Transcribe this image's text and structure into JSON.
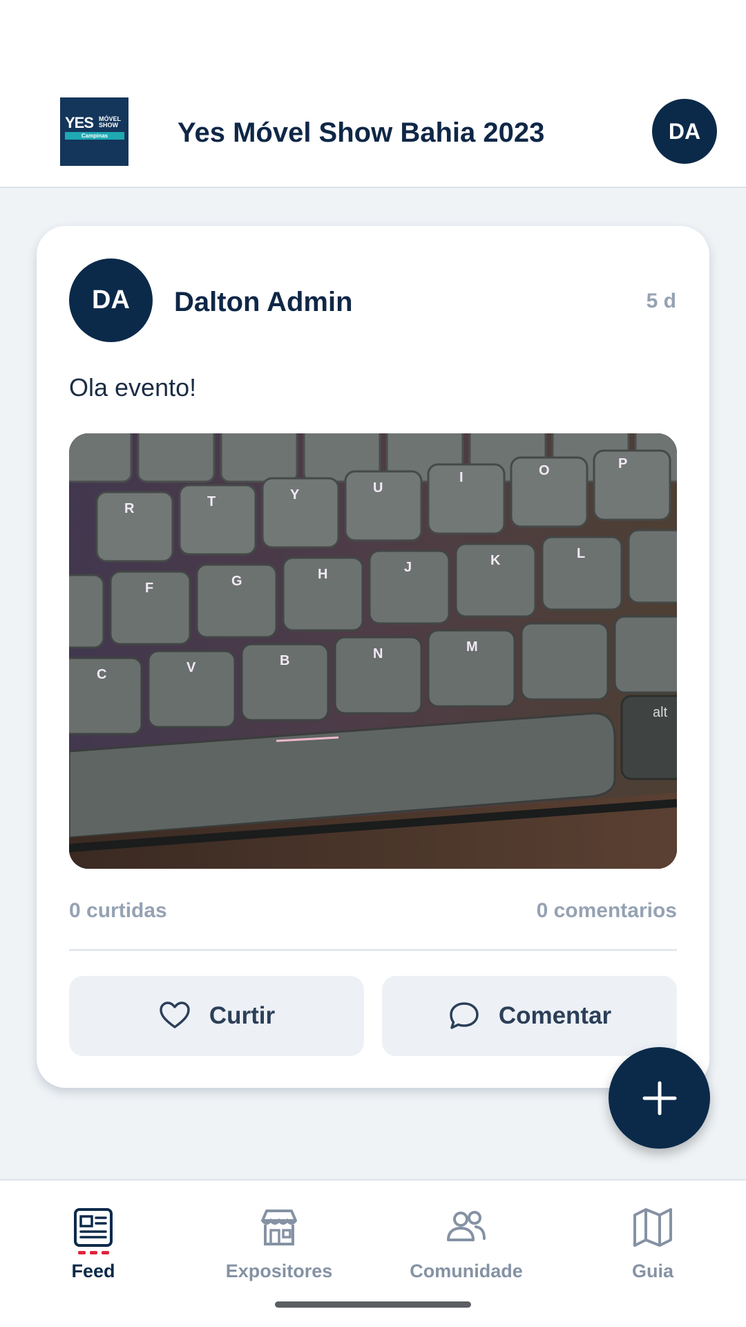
{
  "header": {
    "logo": {
      "line1": "YES",
      "line2": "MÓVEL",
      "line3": "SHOW",
      "city": "Campinas"
    },
    "title": "Yes Móvel Show Bahia 2023",
    "avatar_initials": "DA"
  },
  "post": {
    "avatar_initials": "DA",
    "author": "Dalton Admin",
    "time": "5 d",
    "text": "Ola evento!",
    "image": "keyboard-photo",
    "likes": "0 curtidas",
    "comments": "0 comentarios",
    "like_label": "Curtir",
    "comment_label": "Comentar"
  },
  "fab": {
    "icon": "plus-icon"
  },
  "nav": {
    "items": [
      {
        "label": "Feed",
        "icon": "newspaper-icon",
        "active": true
      },
      {
        "label": "Expositores",
        "icon": "store-icon",
        "active": false
      },
      {
        "label": "Comunidade",
        "icon": "people-icon",
        "active": false
      },
      {
        "label": "Guia",
        "icon": "map-icon",
        "active": false
      }
    ]
  },
  "colors": {
    "primary": "#0b2a4a",
    "muted": "#95a2b3",
    "accent_dots": "#e0253a",
    "background": "#eff3f6"
  }
}
